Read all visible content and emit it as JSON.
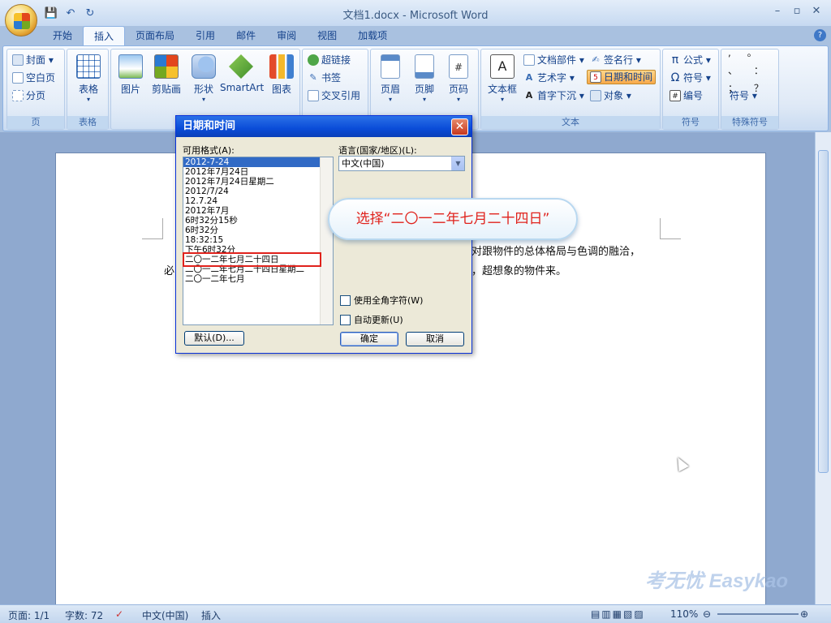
{
  "window": {
    "title": "文档1.docx - Microsoft Word",
    "minimize": "–",
    "restore": "▫",
    "close": "✕"
  },
  "qat": {
    "save": "💾",
    "undo": "↶",
    "redo": "↻"
  },
  "tabs": [
    {
      "label": "开始"
    },
    {
      "label": "插入"
    },
    {
      "label": "页面布局"
    },
    {
      "label": "引用"
    },
    {
      "label": "邮件"
    },
    {
      "label": "审阅"
    },
    {
      "label": "视图"
    },
    {
      "label": "加载项"
    }
  ],
  "ribbon": {
    "page": {
      "label": "页",
      "items": [
        "封面 ▾",
        "空白页",
        "分页"
      ]
    },
    "table": {
      "label": "表格",
      "button": "表格"
    },
    "illustrations": {
      "items": [
        "图片",
        "剪贴画",
        "形状",
        "SmartArt",
        "图表"
      ]
    },
    "links": {
      "items": [
        "超链接",
        "书签",
        "交叉引用"
      ]
    },
    "header_footer": {
      "items": [
        "页眉",
        "页脚",
        "页码"
      ]
    },
    "text": {
      "label": "文本",
      "textbox": "文本框",
      "items": [
        "文档部件 ▾",
        "艺术字 ▾",
        "首字下沉 ▾",
        "签名行 ▾",
        "日期和时间",
        "对象 ▾"
      ]
    },
    "symbols": {
      "label": "符号",
      "items": [
        "公式 ▾",
        "符号 ▾",
        "编号"
      ]
    },
    "special": {
      "label": "特殊符号",
      "chars": ", 。 、 ： ； ？",
      "button": "符号 ▾"
    }
  },
  "document": {
    "line1": "对跟物件的总体格局与色调的融洽，",
    "line2_start": "必",
    "line2_end": "，超想象的物件来。"
  },
  "dialog": {
    "title": "日期和时间",
    "formats_label": "可用格式(A):",
    "formats": [
      "2012-7-24",
      "2012年7月24日",
      "2012年7月24日星期二",
      "2012/7/24",
      "12.7.24",
      "2012年7月",
      "6时32分15秒",
      "6时32分",
      "18:32:15",
      "下午6时32分",
      "二〇一二年七月二十四日",
      "二〇一二年七月二十四日星期二",
      "二〇一二年七月"
    ],
    "language_label": "语言(国家/地区)(L):",
    "language_value": "中文(中国)",
    "fullwidth_label": "使用全角字符(W)",
    "autoupdate_label": "自动更新(U)",
    "default_button": "默认(D)...",
    "ok_button": "确定",
    "cancel_button": "取消"
  },
  "callout": "选择“二〇一二年七月二十四日”",
  "status": {
    "page": "页面: 1/1",
    "words": "字数: 72",
    "language": "中文(中国)",
    "mode": "插入",
    "zoom": "110%"
  },
  "watermark": "考无忧 Easykao"
}
